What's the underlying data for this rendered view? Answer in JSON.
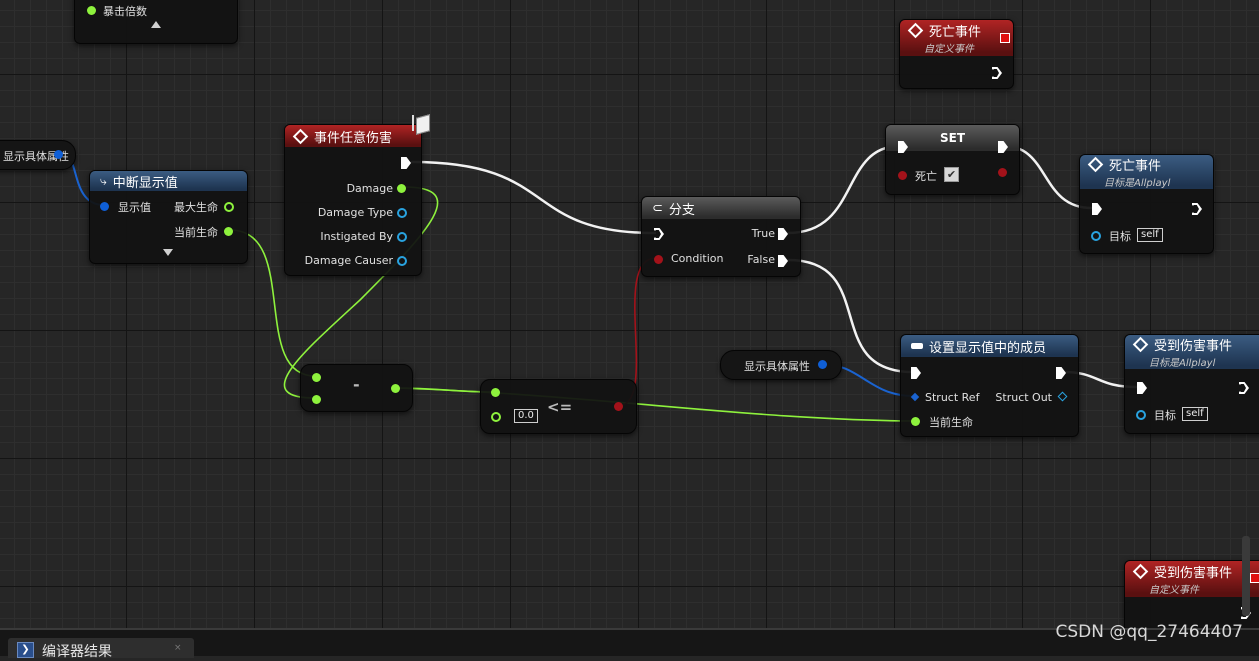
{
  "nodes": {
    "top_stub": {
      "pin_label": "暴击倍数"
    },
    "death_event_custom": {
      "title": "死亡事件",
      "subtitle": "自定义事件"
    },
    "display_var_left": {
      "label": "显示具体属性"
    },
    "break_struct": {
      "title": "中断显示值",
      "in_pin": "显示值",
      "out_max": "最大生命",
      "out_current": "当前生命"
    },
    "any_damage": {
      "title": "事件任意伤害",
      "pins": [
        "Damage",
        "Damage Type",
        "Instigated By",
        "Damage Causer"
      ]
    },
    "subtract": {
      "op": "-"
    },
    "lte": {
      "op": "<=",
      "value": "0.0"
    },
    "branch": {
      "title": "分支",
      "condition": "Condition",
      "true_label": "True",
      "false_label": "False"
    },
    "set_node": {
      "title": "SET",
      "var_label": "死亡"
    },
    "death_call": {
      "title": "死亡事件",
      "subtitle": "目标是Allplayl",
      "target_label": "目标",
      "target_value": "self"
    },
    "display_var_right": {
      "label": "显示具体属性"
    },
    "set_members": {
      "title": "设置显示值中的成员",
      "struct_ref": "Struct Ref",
      "struct_out": "Struct Out",
      "current_hp": "当前生命"
    },
    "damage_call": {
      "title": "受到伤害事件",
      "subtitle": "目标是Allplayl",
      "target_label": "目标",
      "target_value": "self"
    },
    "damage_event_custom": {
      "title": "受到伤害事件",
      "subtitle": "自定义事件"
    }
  },
  "bottom": {
    "tab_label": "编译器结果",
    "watermark": "CSDN @qq_27464407"
  },
  "colors": {
    "exec": "#ffffff",
    "float": "#8ef23d",
    "struct": "#0f5fd6",
    "bool": "#a3121a",
    "event_header": "#b02424",
    "function_header": "#3b5c82"
  }
}
